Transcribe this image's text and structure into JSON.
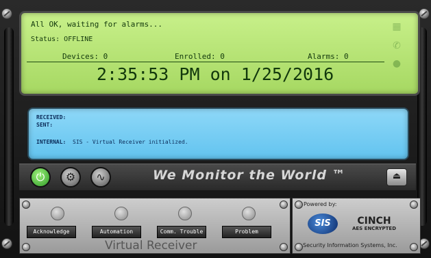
{
  "status_display": {
    "message": "All OK, waiting for alarms...",
    "status": "Status: OFFLINE",
    "devices": "Devices: 0",
    "enrolled": "Enrolled: 0",
    "alarms": "Alarms: 0",
    "clock": "2:35:53 PM on 1/25/2016"
  },
  "log": {
    "received_label": "RECEIVED:",
    "sent_label": "SENT:",
    "internal_label": "INTERNAL:",
    "internal_text": "SIS - Virtual Receiver initialized."
  },
  "toolbar": {
    "slogan": "We Monitor the World ™"
  },
  "functions": {
    "buttons": [
      "Acknowledge",
      "Automation",
      "Comm. Trouble",
      "Problem"
    ],
    "brand_label": "Virtual Receiver"
  },
  "powered": {
    "label": "Powered by:",
    "sis_logo": "SIS",
    "cinch_logo": "CINCH",
    "aes_label": "AES ENCRYPTED",
    "company": "Security Information Systems, Inc."
  },
  "icons": {
    "power": "power-icon",
    "settings": "gear-icon",
    "heartbeat": "heartbeat-icon",
    "eject": "eject-icon"
  },
  "colors": {
    "lcd_green": "#b6e478",
    "log_blue": "#7ccff3",
    "power_green": "#3cb634"
  }
}
